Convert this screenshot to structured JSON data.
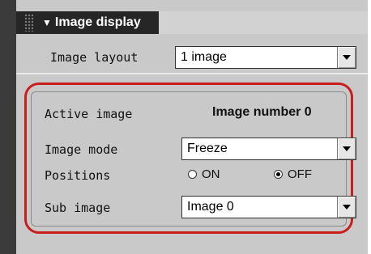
{
  "section": {
    "title": "Image display"
  },
  "image_layout": {
    "label": "Image layout",
    "value": "1 image"
  },
  "active_image": {
    "label": "Active image",
    "value": "Image number 0"
  },
  "image_mode": {
    "label": "Image mode",
    "value": "Freeze"
  },
  "positions": {
    "label": "Positions",
    "options": [
      {
        "label": "ON",
        "selected": false
      },
      {
        "label": "OFF",
        "selected": true
      }
    ]
  },
  "sub_image": {
    "label": "Sub image",
    "value": "Image 0"
  },
  "colors": {
    "highlight": "#c81e1e",
    "panel": "#c9c9c9",
    "header": "#262626"
  }
}
